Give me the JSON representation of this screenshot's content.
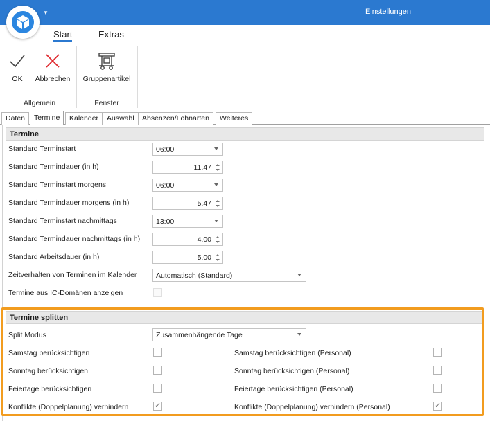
{
  "window": {
    "title": "Einstellungen"
  },
  "ribbon": {
    "tabs": [
      "Start",
      "Extras"
    ],
    "active_tab": "Start",
    "buttons": {
      "ok": "OK",
      "cancel": "Abbrechen",
      "group_articles": "Gruppenartikel"
    },
    "groups": {
      "general": "Allgemein",
      "window": "Fenster"
    }
  },
  "tabs": [
    "Daten",
    "Termine",
    "Kalender",
    "Auswahl",
    "Absenzen/Lohnarten",
    "Weiteres"
  ],
  "active_tab": "Termine",
  "termine": {
    "header": "Termine",
    "standard_start": {
      "label": "Standard Terminstart",
      "value": "06:00"
    },
    "standard_duration": {
      "label": "Standard Termindauer (in h)",
      "value": "11.47"
    },
    "morning_start": {
      "label": "Standard Terminstart morgens",
      "value": "06:00"
    },
    "morning_duration": {
      "label": "Standard Termindauer morgens (in h)",
      "value": "5.47"
    },
    "afternoon_start": {
      "label": "Standard Terminstart nachmittags",
      "value": "13:00"
    },
    "afternoon_duration": {
      "label": "Standard Termindauer nachmittags (in h)",
      "value": "4.00"
    },
    "work_duration": {
      "label": "Standard Arbeitsdauer (in h)",
      "value": "5.00"
    },
    "time_behavior": {
      "label": "Zeitverhalten von Terminen im Kalender",
      "value": "Automatisch (Standard)"
    },
    "ic_domains": {
      "label": "Termine aus IC-Domänen anzeigen",
      "checked": false,
      "enabled": false
    }
  },
  "split": {
    "header": "Termine splitten",
    "mode": {
      "label": "Split Modus",
      "value": "Zusammenhängende Tage"
    },
    "saturday": {
      "label": "Samstag berücksichtigen",
      "checked": false
    },
    "saturday_personal": {
      "label": "Samstag berücksichtigen (Personal)",
      "checked": false
    },
    "sunday": {
      "label": "Sonntag berücksichtigen",
      "checked": false
    },
    "sunday_personal": {
      "label": "Sonntag berücksichtigen (Personal)",
      "checked": false
    },
    "holidays": {
      "label": "Feiertage berücksichtigen",
      "checked": false
    },
    "holidays_personal": {
      "label": "Feiertage berücksichtigen (Personal)",
      "checked": false
    },
    "conflicts": {
      "label": "Konflikte (Doppelplanung) verhindern",
      "checked": true
    },
    "conflicts_personal": {
      "label": "Konflikte (Doppelplanung) verhindern (Personal)",
      "checked": true
    }
  },
  "colors": {
    "titlebar": "#2b79d0",
    "accent": "#2b79d0",
    "highlight": "#f29c1f",
    "cancel_icon": "#e0282d"
  },
  "icons": {
    "app": "cube-icon",
    "ok": "checkmark-icon",
    "cancel": "cross-icon",
    "group_articles": "forklift-icon"
  }
}
